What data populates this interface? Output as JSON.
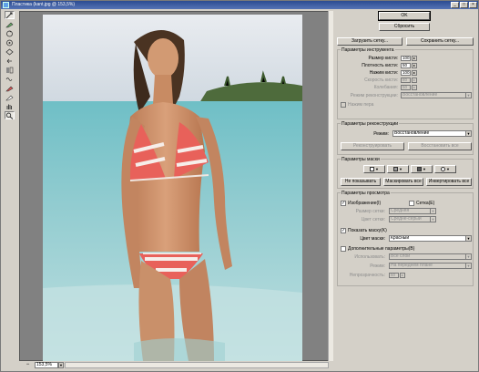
{
  "window": {
    "title": "Пластика (kant.jpg @ 153,5%)",
    "controls": [
      "_",
      "□",
      "×"
    ]
  },
  "tools": [
    {
      "name": "forward-warp-tool-icon"
    },
    {
      "name": "reconstruct-tool-icon"
    },
    {
      "name": "twirl-tool-icon"
    },
    {
      "name": "pucker-tool-icon"
    },
    {
      "name": "bloat-tool-icon"
    },
    {
      "name": "push-left-tool-icon"
    },
    {
      "name": "mirror-tool-icon"
    },
    {
      "name": "turbulence-tool-icon"
    },
    {
      "name": "freeze-mask-tool-icon"
    },
    {
      "name": "thaw-mask-tool-icon"
    },
    {
      "name": "hand-tool-icon"
    },
    {
      "name": "zoom-tool-icon"
    }
  ],
  "statusbar": {
    "zoom_minus": "−",
    "zoom_value": "153,5%",
    "zoom_dropdown": "▼"
  },
  "buttons": {
    "ok": "OK",
    "reset": "Сбросить",
    "load_mesh": "Загрузить сетку...",
    "save_mesh": "Сохранить сетку..."
  },
  "tool_options": {
    "title": "Параметры инструмента",
    "brush_size": {
      "label": "Размер кисти:",
      "value": "100"
    },
    "brush_density": {
      "label": "Плотность кисти:",
      "value": "50"
    },
    "brush_pressure": {
      "label": "Нажим кисти:",
      "value": "100"
    },
    "brush_rate": {
      "label": "Скорость кисти:",
      "value": "80"
    },
    "turbulent_jitter": {
      "label": "Колебания:",
      "value": "50"
    },
    "reconstruct_mode": {
      "label": "Режим реконструкции:",
      "value": "Восстановление"
    },
    "stylus_pressure": {
      "label": "Нажим пера",
      "checked": false
    }
  },
  "reconstruct_options": {
    "title": "Параметры реконструкции",
    "mode": {
      "label": "Режим:",
      "value": "Восстановление"
    },
    "reconstruct": "Реконструировать",
    "restore_all": "Восстановить все"
  },
  "mask_options": {
    "title": "Параметры маски",
    "none": "Не показывать",
    "mask_all": "Маскировать все",
    "invert_all": "Инвертировать все"
  },
  "view_options": {
    "title": "Параметры просмотра",
    "show_image": {
      "label": "Изображение(I)",
      "checked": true
    },
    "show_mesh": {
      "label": "Сетка(E)",
      "checked": false
    },
    "mesh_size": {
      "label": "Размер сетки:",
      "value": "Средняя"
    },
    "mesh_color": {
      "label": "Цвет сетки:",
      "value": "Средне-серый"
    },
    "show_mask": {
      "label": "Показать маску(K)",
      "checked": true
    },
    "mask_color": {
      "label": "Цвет маски:",
      "value": "Красный"
    },
    "show_backdrop": {
      "label": "Дополнительные параметры(B)",
      "checked": false
    },
    "use": {
      "label": "Использовать:",
      "value": "Все слои"
    },
    "backdrop_mode": {
      "label": "Режим:",
      "value": "На переднем плане"
    },
    "opacity": {
      "label": "Непрозрачность:",
      "value": "50"
    }
  },
  "colors": {
    "titlebar": "#2b4b91",
    "panel": "#d4d0c8",
    "canvas_bg": "#818181",
    "bikini": "#e8615a"
  }
}
